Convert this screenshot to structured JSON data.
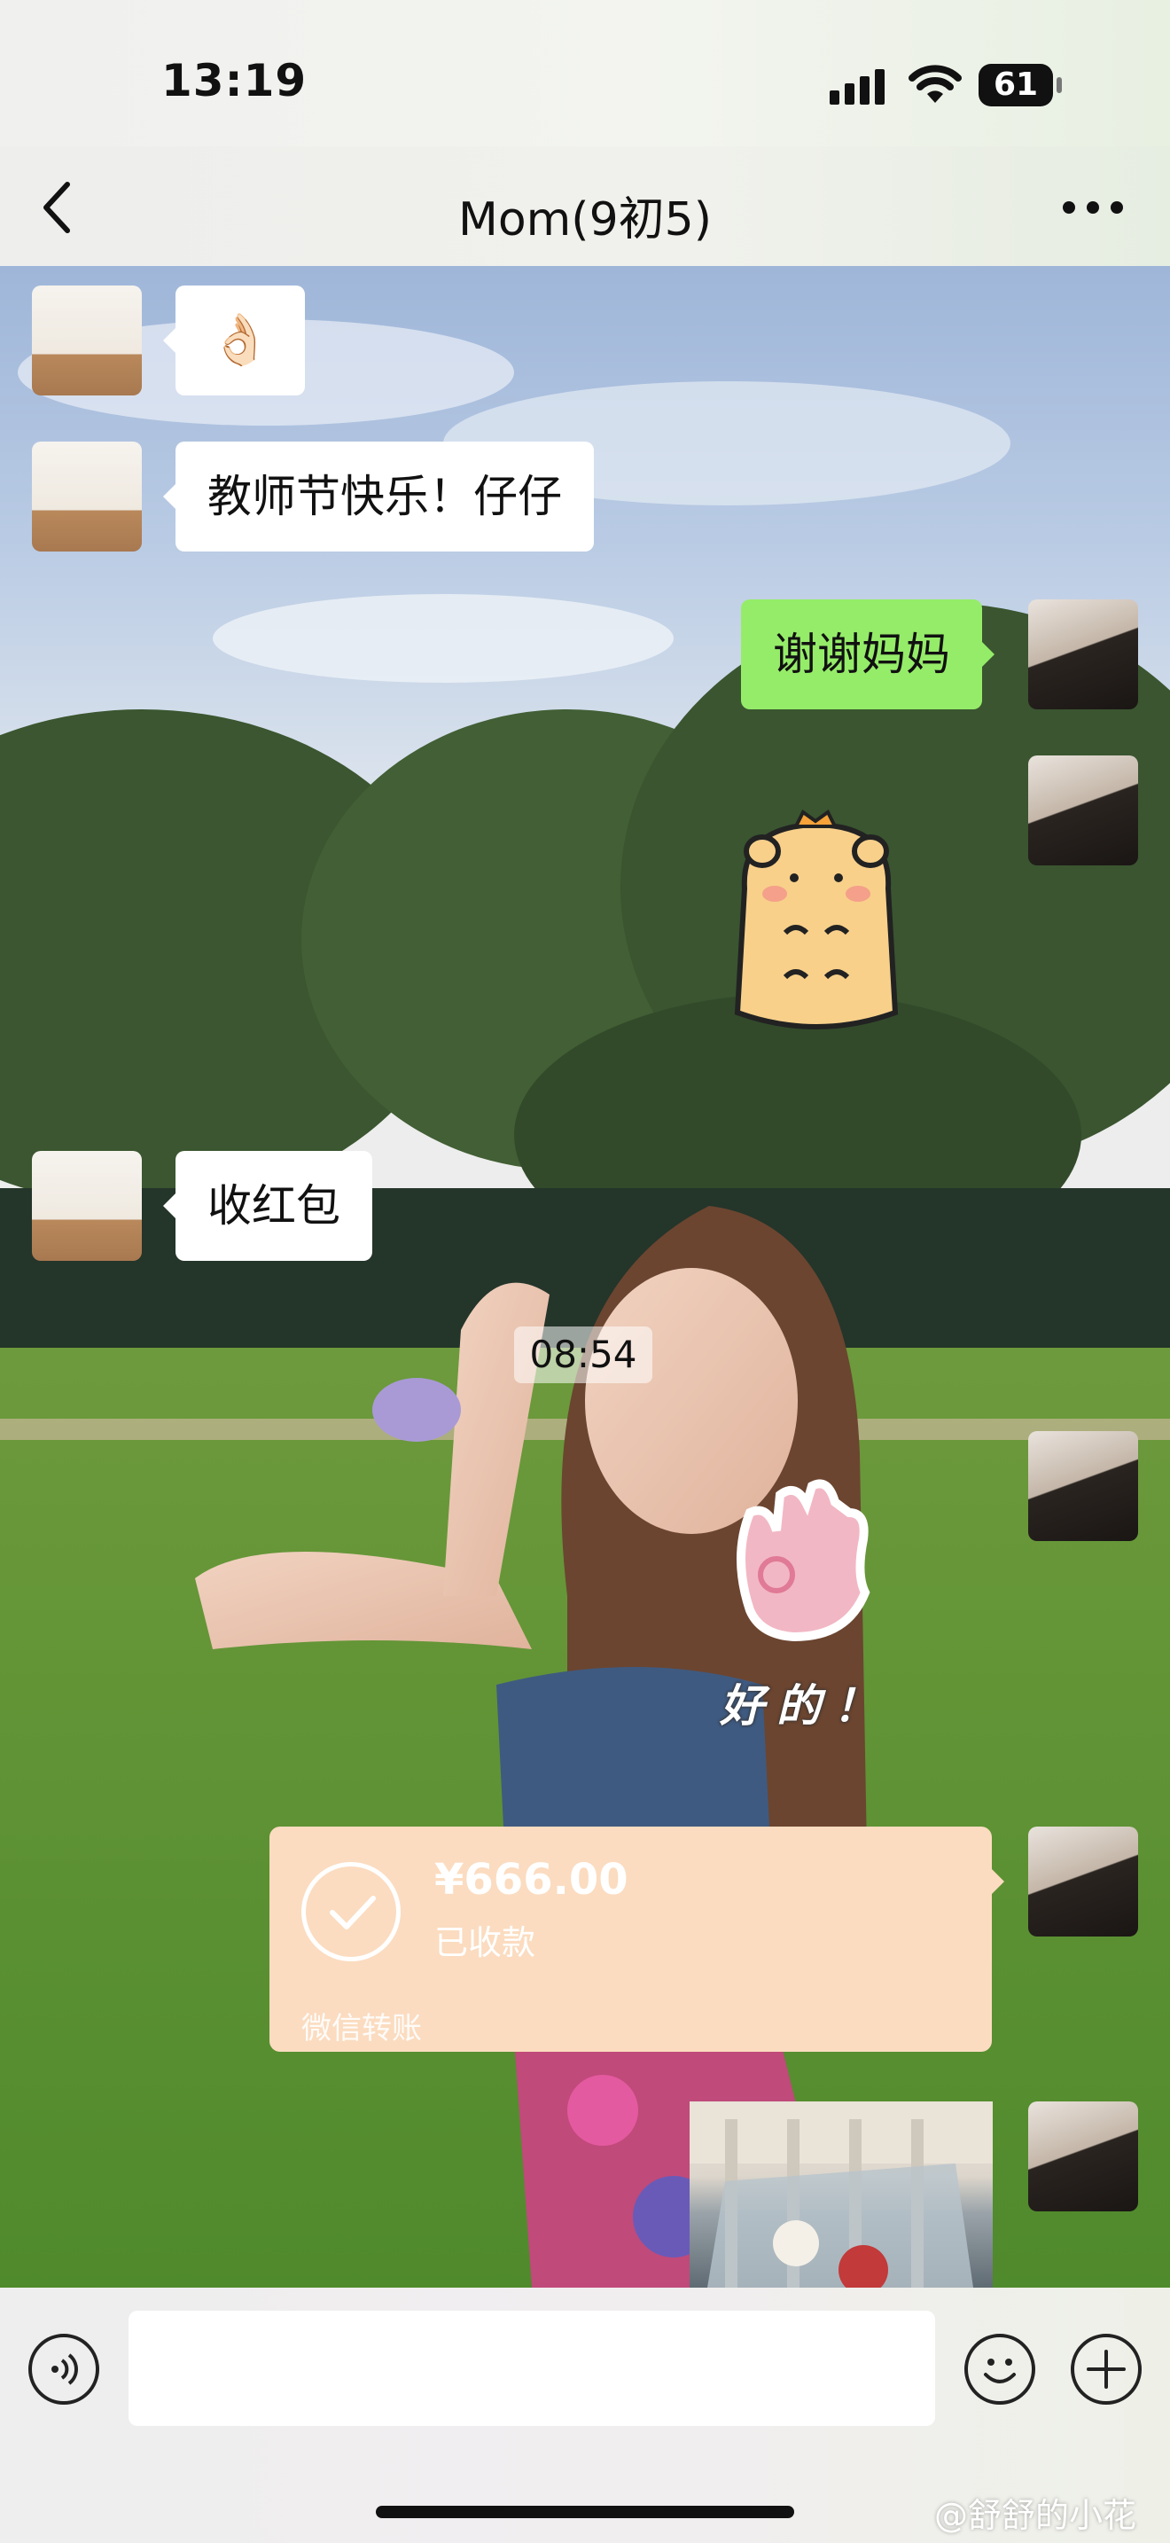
{
  "status_bar": {
    "time": "13:19",
    "battery": "61",
    "icons": [
      "signal-icon",
      "wifi-icon",
      "battery-icon"
    ]
  },
  "nav": {
    "title": "Mom(9初5)",
    "back_icon": "chevron-left-icon",
    "more_icon": "more-dots-icon"
  },
  "messages": [
    {
      "sender": "mom",
      "type": "emoji",
      "text": "👌🏻"
    },
    {
      "sender": "mom",
      "type": "text",
      "text": "教师节快乐！仔仔"
    },
    {
      "sender": "me",
      "type": "text",
      "text": "谢谢妈妈"
    },
    {
      "sender": "me",
      "type": "sticker",
      "sticker": "hamster-sticker"
    },
    {
      "sender": "mom",
      "type": "text",
      "text": "收红包"
    },
    {
      "sender": "system",
      "type": "timestamp",
      "text": "08:54"
    },
    {
      "sender": "me",
      "type": "sticker",
      "sticker": "ok-hand-sticker",
      "text": "好的！"
    },
    {
      "sender": "me",
      "type": "transfer",
      "amount": "¥666.00",
      "status": "已收款",
      "brand": "微信转账"
    },
    {
      "sender": "me",
      "type": "image",
      "image": "photo-thumbnail"
    }
  ],
  "input_bar": {
    "voice_icon": "voice-icon",
    "emoji_icon": "smiley-icon",
    "plus_icon": "plus-icon",
    "input_value": ""
  },
  "watermark": "@舒舒的小花",
  "colors": {
    "my_bubble": "#95ec69",
    "their_bubble": "#ffffff",
    "transfer_card": "#fbdcc0"
  }
}
